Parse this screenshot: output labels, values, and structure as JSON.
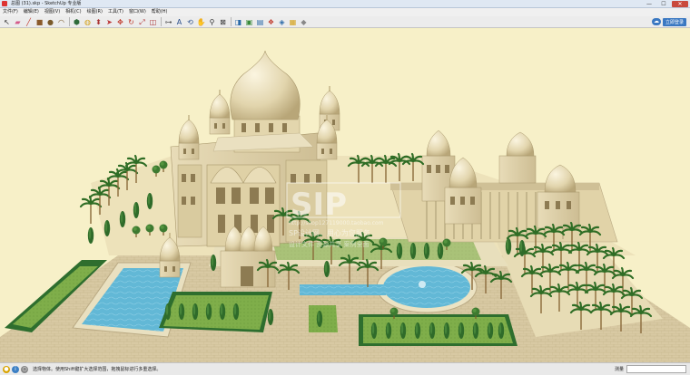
{
  "window": {
    "title": "总图 (31).skp - SketchUp 专业版",
    "controls": {
      "minimize": "—",
      "maximize": "☐",
      "close": "✕"
    }
  },
  "menu": [
    "文件(F)",
    "编辑(E)",
    "视图(V)",
    "相机(C)",
    "绘图(R)",
    "工具(T)",
    "窗口(W)",
    "帮助(H)"
  ],
  "toolbar": {
    "tools": [
      {
        "name": "select-tool-icon",
        "glyph": "↖",
        "color": "#333333"
      },
      {
        "name": "eraser-tool-icon",
        "glyph": "▰",
        "color": "#d45a8a"
      },
      {
        "name": "line-tool-icon",
        "glyph": "╱",
        "color": "#c0392b"
      },
      {
        "name": "rectangle-tool-icon",
        "glyph": "■",
        "color": "#8a5a2b"
      },
      {
        "name": "circle-tool-icon",
        "glyph": "●",
        "color": "#7a5a2b"
      },
      {
        "name": "arc-tool-icon",
        "glyph": "◠",
        "color": "#7a5a2b"
      },
      {
        "name": "polygon-tool-icon",
        "glyph": "⬢",
        "color": "#2e6b3a"
      },
      {
        "name": "paint-bucket-icon",
        "glyph": "◍",
        "color": "#d4a017"
      },
      {
        "name": "push-pull-icon",
        "glyph": "⬍",
        "color": "#a33"
      },
      {
        "name": "follow-me-icon",
        "glyph": "➤",
        "color": "#b33"
      },
      {
        "name": "move-tool-icon",
        "glyph": "✥",
        "color": "#c0392b"
      },
      {
        "name": "rotate-tool-icon",
        "glyph": "↻",
        "color": "#c0392b"
      },
      {
        "name": "scale-tool-icon",
        "glyph": "⤢",
        "color": "#b03030"
      },
      {
        "name": "offset-tool-icon",
        "glyph": "◫",
        "color": "#a33"
      },
      {
        "name": "tape-measure-icon",
        "glyph": "⊶",
        "color": "#555555"
      },
      {
        "name": "text-tool-icon",
        "glyph": "A",
        "color": "#2a4f8a"
      },
      {
        "name": "orbit-tool-icon",
        "glyph": "⟲",
        "color": "#2a4f8a"
      },
      {
        "name": "pan-tool-icon",
        "glyph": "✋",
        "color": "#444444"
      },
      {
        "name": "zoom-tool-icon",
        "glyph": "⚲",
        "color": "#333333"
      },
      {
        "name": "zoom-extents-icon",
        "glyph": "⊠",
        "color": "#333333"
      },
      {
        "name": "previous-view-icon",
        "glyph": "◨",
        "color": "#2a6aa8"
      },
      {
        "name": "get-models-icon",
        "glyph": "▣",
        "color": "#3a8a3a"
      },
      {
        "name": "share-model-icon",
        "glyph": "▤",
        "color": "#2a6aa8"
      },
      {
        "name": "components-icon",
        "glyph": "❖",
        "color": "#c0392b"
      },
      {
        "name": "extension-warehouse-icon",
        "glyph": "◈",
        "color": "#2a6aa8"
      },
      {
        "name": "layout-icon",
        "glyph": "▦",
        "color": "#d4a017"
      },
      {
        "name": "style-builder-icon",
        "glyph": "◆",
        "color": "#888888"
      }
    ],
    "signin_label": "立即登录"
  },
  "viewport": {
    "background": "#f7f0c8",
    "watermark_main": "SIP",
    "watermark_url": "http://shop127119000.taobao.com",
    "watermark_line2": "SP设计网，用心为您服务",
    "watermark_line3": "设计文件    资源共享    案例全面"
  },
  "statusbar": {
    "text": "选择物体。使用Shift键扩大选择范围，拖拽鼠标进行多重选择。",
    "measure_label": "测量"
  }
}
